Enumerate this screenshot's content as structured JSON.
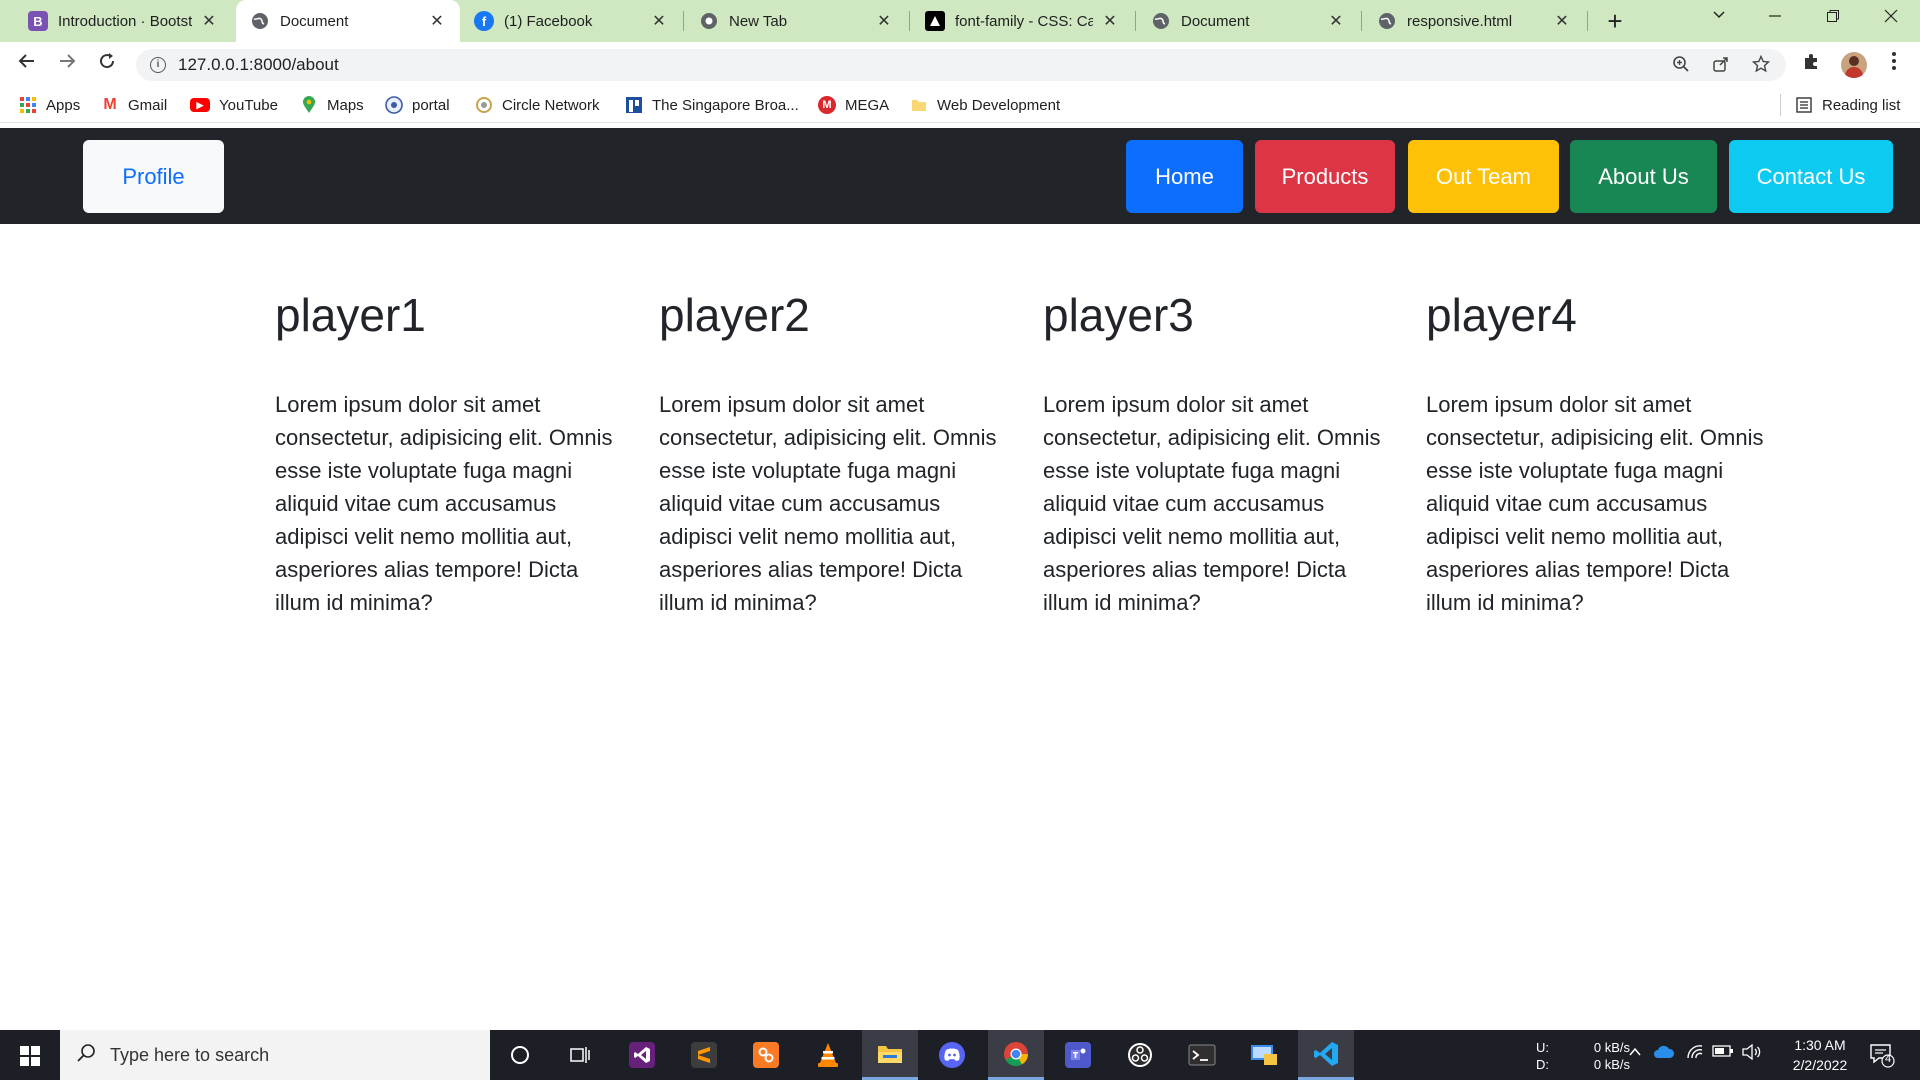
{
  "browser": {
    "tabs": [
      {
        "title": "Introduction · Bootstrap",
        "icon": "bootstrap-icon",
        "icon_text": "B",
        "active": false
      },
      {
        "title": "Document",
        "icon": "globe-icon",
        "active": true
      },
      {
        "title": "(1) Facebook",
        "icon": "facebook-icon",
        "icon_text": "f",
        "active": false
      },
      {
        "title": "New Tab",
        "icon": "chrome-icon",
        "active": false
      },
      {
        "title": "font-family - CSS: Cas",
        "icon": "mdn-icon",
        "active": false
      },
      {
        "title": "Document",
        "icon": "globe-icon",
        "active": false
      },
      {
        "title": "responsive.html",
        "icon": "globe-icon",
        "active": false
      }
    ],
    "tab_close_symbol": "✕",
    "new_tab_symbol": "+",
    "url": "127.0.0.1:8000/about",
    "bookmarks": [
      {
        "label": "Apps",
        "icon": "apps-grid-icon"
      },
      {
        "label": "Gmail",
        "icon": "gmail-icon",
        "icon_text": "M"
      },
      {
        "label": "YouTube",
        "icon": "youtube-icon",
        "icon_text": "▶"
      },
      {
        "label": "Maps",
        "icon": "maps-pin-icon"
      },
      {
        "label": "portal",
        "icon": "portal-icon"
      },
      {
        "label": "Circle Network",
        "icon": "circle-network-icon"
      },
      {
        "label": "The Singapore Broa...",
        "icon": "singapore-broadcast-icon"
      },
      {
        "label": "MEGA",
        "icon": "mega-icon",
        "icon_text": "M"
      },
      {
        "label": "Web Development",
        "icon": "folder-icon"
      }
    ],
    "reading_list": "Reading list"
  },
  "navbar": {
    "profile": "Profile",
    "items": [
      {
        "label": "Home",
        "color": "#0d6efd"
      },
      {
        "label": "Products",
        "color": "#dc3545"
      },
      {
        "label": "Out Team",
        "color": "#ffc107"
      },
      {
        "label": "About Us",
        "color": "#198754"
      },
      {
        "label": "Contact Us",
        "color": "#0dcaf0"
      }
    ]
  },
  "players": [
    {
      "name": "player1",
      "text": "Lorem ipsum dolor sit amet consectetur, adipisicing elit. Omnis esse iste voluptate fuga magni aliquid vitae cum accusamus adipisci velit nemo mollitia aut, asperiores alias tempore! Dicta illum id minima?"
    },
    {
      "name": "player2",
      "text": "Lorem ipsum dolor sit amet consectetur, adipisicing elit. Omnis esse iste voluptate fuga magni aliquid vitae cum accusamus adipisci velit nemo mollitia aut, asperiores alias tempore! Dicta illum id minima?"
    },
    {
      "name": "player3",
      "text": "Lorem ipsum dolor sit amet consectetur, adipisicing elit. Omnis esse iste voluptate fuga magni aliquid vitae cum accusamus adipisci velit nemo mollitia aut, asperiores alias tempore! Dicta illum id minima?"
    },
    {
      "name": "player4",
      "text": "Lorem ipsum dolor sit amet consectetur, adipisicing elit. Omnis esse iste voluptate fuga magni aliquid vitae cum accusamus adipisci velit nemo mollitia aut, asperiores alias tempore! Dicta illum id minima?"
    }
  ],
  "taskbar": {
    "search_placeholder": "Type here to search",
    "net_upload_label": "U:",
    "net_download_label": "D:",
    "net_upload": "0 kB/s",
    "net_download": "0 kB/s",
    "time": "1:30 AM",
    "date": "2/2/2022",
    "notification_count": "4"
  }
}
